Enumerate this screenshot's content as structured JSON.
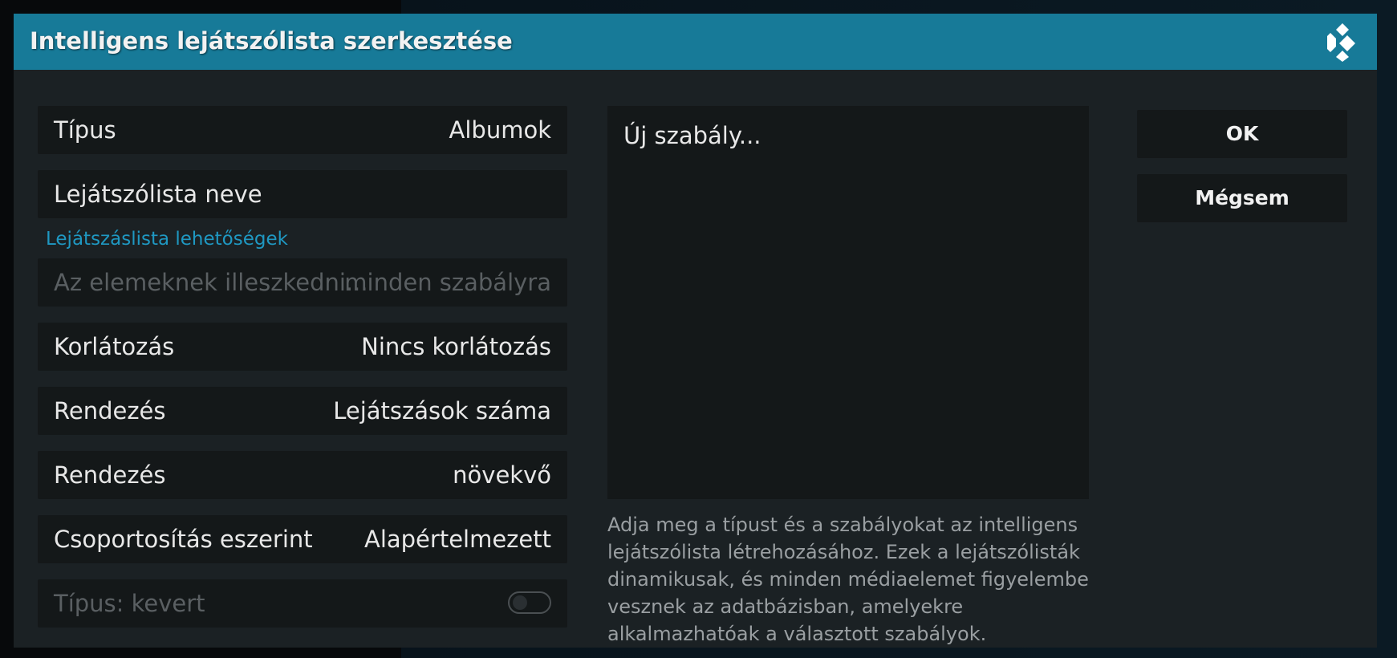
{
  "dialog": {
    "title": "Intelligens lejátszólista szerkesztése",
    "logo_icon": "kodi-logo-icon"
  },
  "settings": {
    "type": {
      "label": "Típus",
      "value": "Albumok"
    },
    "name": {
      "label": "Lejátszólista neve",
      "value": ""
    },
    "section_label": "Lejátszáslista lehetőségek",
    "match": {
      "label": "Az elemeknek illeszkedni...",
      "value": "minden szabályra",
      "disabled": true
    },
    "limit": {
      "label": "Korlátozás",
      "value": "Nincs korlátozás"
    },
    "order_by": {
      "label": "Rendezés",
      "value": "Lejátszások száma"
    },
    "order_direction": {
      "label": "Rendezés",
      "value": "növekvő"
    },
    "group_by": {
      "label": "Csoportosítás eszerint",
      "value": "Alapértelmezett"
    },
    "mixed": {
      "label": "Típus: kevert",
      "toggle_on": false,
      "disabled": true
    }
  },
  "rules": {
    "items": [
      "Új szabály..."
    ]
  },
  "help_text": "Adja meg a típust és a szabályokat az intelligens lejátszólista létrehozásához. Ezek a lejátszólisták dinamikusak, és minden médiaelemet figyelembe vesznek az adatbázisban, amelyekre alkalmazhatóak a választott szabályok.",
  "buttons": {
    "ok": "OK",
    "cancel": "Mégsem"
  },
  "colors": {
    "titlebar": "#177a98",
    "accent": "#1f98c2",
    "dialog_bg": "#1b2124",
    "row_bg": "#141819"
  }
}
